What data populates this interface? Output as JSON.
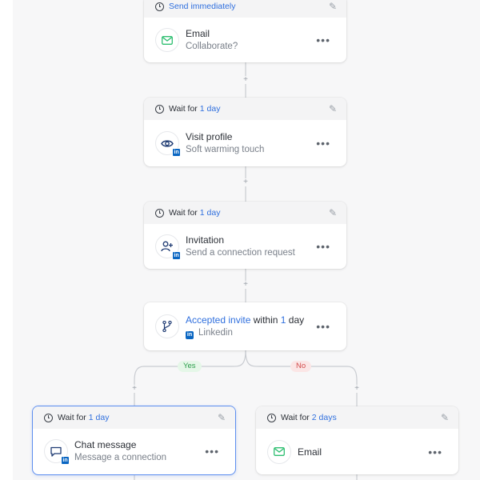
{
  "colors": {
    "accent": "#2f6fde",
    "linkedin": "#0a66c2",
    "email_green": "#2fbf71",
    "yes": "#2a9d4a",
    "no": "#d24c4c"
  },
  "plus_symbol": "+",
  "steps": {
    "email1": {
      "header_text": "Send immediately",
      "title": "Email",
      "subtitle": "Collaborate?",
      "icon": "mail-icon"
    },
    "visit": {
      "header_prefix": "Wait for",
      "header_value": "1 day",
      "title": "Visit profile",
      "subtitle": "Soft warming touch",
      "icon": "eye-icon",
      "badge": "in"
    },
    "invite": {
      "header_prefix": "Wait for",
      "header_value": "1 day",
      "title": "Invitation",
      "subtitle": "Send a connection request",
      "icon": "user-plus-icon",
      "badge": "in"
    },
    "condition": {
      "title_link": "Accepted invite",
      "title_mid": "within",
      "title_value": "1",
      "title_unit": "day",
      "subtitle": "Linkedin",
      "icon": "branch-icon",
      "badge": "in"
    },
    "chat": {
      "header_prefix": "Wait for",
      "header_value": "1 day",
      "title": "Chat message",
      "subtitle": "Message a connection",
      "icon": "chat-icon",
      "badge": "in"
    },
    "email2": {
      "header_prefix": "Wait for",
      "header_value": "2 days",
      "title": "Email",
      "icon": "mail-icon"
    }
  },
  "branches": {
    "yes": "Yes",
    "no": "No"
  },
  "more_label": "•••",
  "edit_glyph": "✎"
}
